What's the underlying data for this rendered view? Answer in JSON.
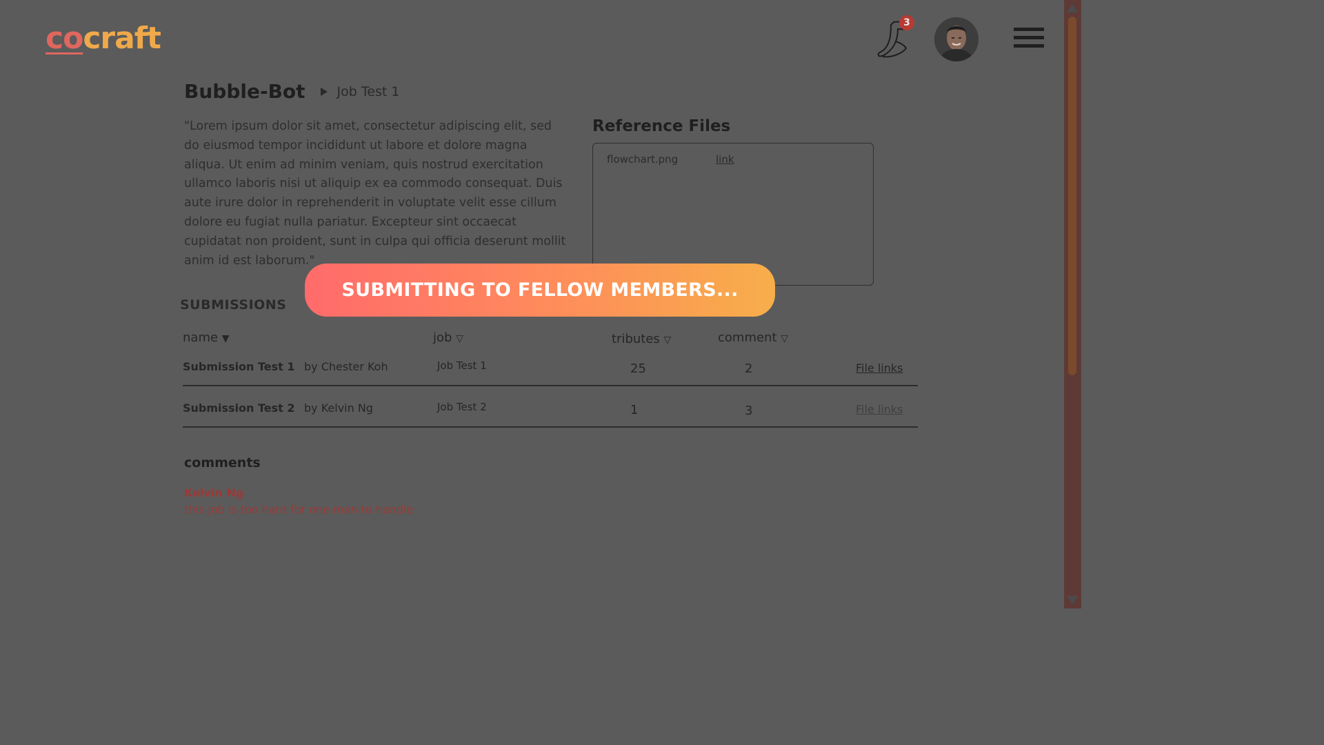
{
  "header": {
    "logo_co": "co",
    "logo_craft": "craft",
    "notification_count": "3",
    "icons": {
      "notifications": "horn-icon",
      "menu": "hamburger-menu-icon",
      "avatar": "user-avatar"
    }
  },
  "breadcrumb": {
    "project": "Bubble-Bot",
    "job": "Job Test 1"
  },
  "description": "\"Lorem ipsum dolor sit amet, consectetur adipiscing elit, sed do eiusmod tempor incididunt ut labore et dolore magna aliqua. Ut enim ad minim veniam, quis nostrud exercitation ullamco laboris nisi ut aliquip ex ea commodo consequat. Duis aute irure dolor in reprehenderit in voluptate velit esse cillum dolore eu fugiat nulla pariatur. Excepteur sint occaecat cupidatat non proident, sunt in culpa qui officia deserunt mollit anim id est laborum.\"",
  "reference_files": {
    "title": "Reference Files",
    "files": [
      {
        "name": "flowchart.png",
        "link_label": "link"
      }
    ]
  },
  "overlay": {
    "label": "SUBMITTING TO  FELLOW MEMBERS..."
  },
  "submissions": {
    "title": "SUBMISSIONS",
    "headers": {
      "name": "name",
      "job": "job",
      "tributes": "tributes",
      "comment": "comment"
    },
    "rows": [
      {
        "name": "Submission Test 1",
        "by": "by Chester Koh",
        "job": "Job Test 1",
        "tributes": "25",
        "comments": "2",
        "files": "File links"
      },
      {
        "name": "Submission Test 2",
        "by": "by Kelvin Ng",
        "job": "Job Test 2",
        "tributes": "1",
        "comments": "3",
        "files": "File links"
      }
    ]
  },
  "comments": {
    "title": "comments",
    "items": [
      {
        "author": "Kelvin Ng",
        "text": "this job is too hard for one man to handle"
      }
    ]
  },
  "colors": {
    "background": "#5b5b5b",
    "logo_co": "#e0675e",
    "logo_craft": "#f0a94a",
    "overlay_gradient_start": "#ff6b6b",
    "overlay_gradient_end": "#f7ae4a",
    "comment_author": "#9a3a36"
  }
}
